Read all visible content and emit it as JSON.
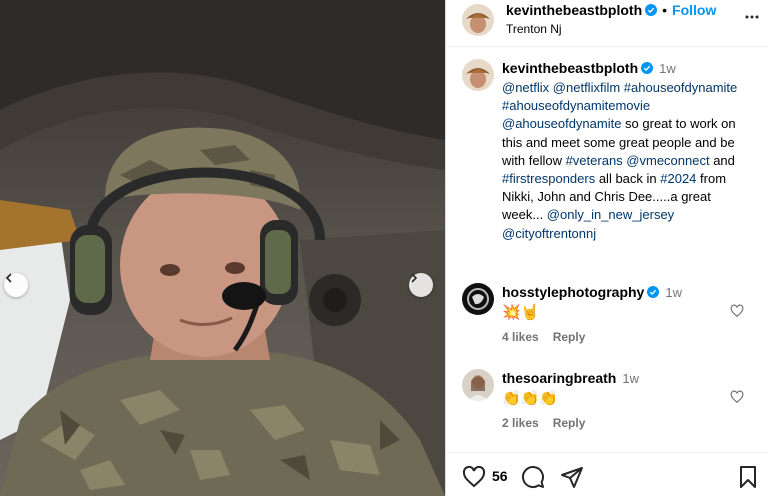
{
  "post": {
    "author": "kevinthebeastbploth",
    "follow_label": "Follow",
    "separator": "•",
    "location": "Trenton Nj",
    "time": "1w",
    "caption_parts": [
      {
        "text": "@netflix",
        "tag": true
      },
      {
        "text": " ",
        "tag": false
      },
      {
        "text": "@netflixfilm",
        "tag": true
      },
      {
        "text": " ",
        "tag": false
      },
      {
        "text": "#ahouseofdynamite",
        "tag": true
      },
      {
        "text": " ",
        "tag": false
      },
      {
        "text": "#ahouseofdynamitemovie",
        "tag": true
      },
      {
        "text": " ",
        "tag": false
      },
      {
        "text": "@ahouseofdynamite",
        "tag": true
      },
      {
        "text": " so great to work on this and meet some great people and be with fellow ",
        "tag": false
      },
      {
        "text": "#veterans",
        "tag": true
      },
      {
        "text": " ",
        "tag": false
      },
      {
        "text": "@vmeconnect",
        "tag": true
      },
      {
        "text": " and ",
        "tag": false
      },
      {
        "text": "#firstresponders",
        "tag": true
      },
      {
        "text": " all back in ",
        "tag": false
      },
      {
        "text": "#2024",
        "tag": true
      },
      {
        "text": " from Nikki, John and Chris Dee.....a great week... ",
        "tag": false
      },
      {
        "text": "@only_in_new_jersey",
        "tag": true
      },
      {
        "text": " ",
        "tag": false
      },
      {
        "text": "@cityoftrentonnj",
        "tag": true
      }
    ],
    "like_count": "56"
  },
  "comments": [
    {
      "user": "hosstylephotography",
      "verified": true,
      "time": "1w",
      "body": "💥🤘",
      "likes": "4 likes",
      "reply": "Reply"
    },
    {
      "user": "thesoaringbreath",
      "verified": false,
      "time": "1w",
      "body": "👏👏👏",
      "likes": "2 likes",
      "reply": "Reply"
    }
  ],
  "icons": {
    "verified": "verified-badge-icon",
    "more": "more-options-icon",
    "prev": "chevron-left-icon",
    "next": "chevron-right-icon",
    "like": "heart-icon",
    "comment": "comment-icon",
    "share": "share-icon",
    "save": "bookmark-icon"
  },
  "colors": {
    "accent": "#0095f6",
    "tag": "#00376b",
    "muted": "#737373",
    "verified": "#0095f6"
  }
}
